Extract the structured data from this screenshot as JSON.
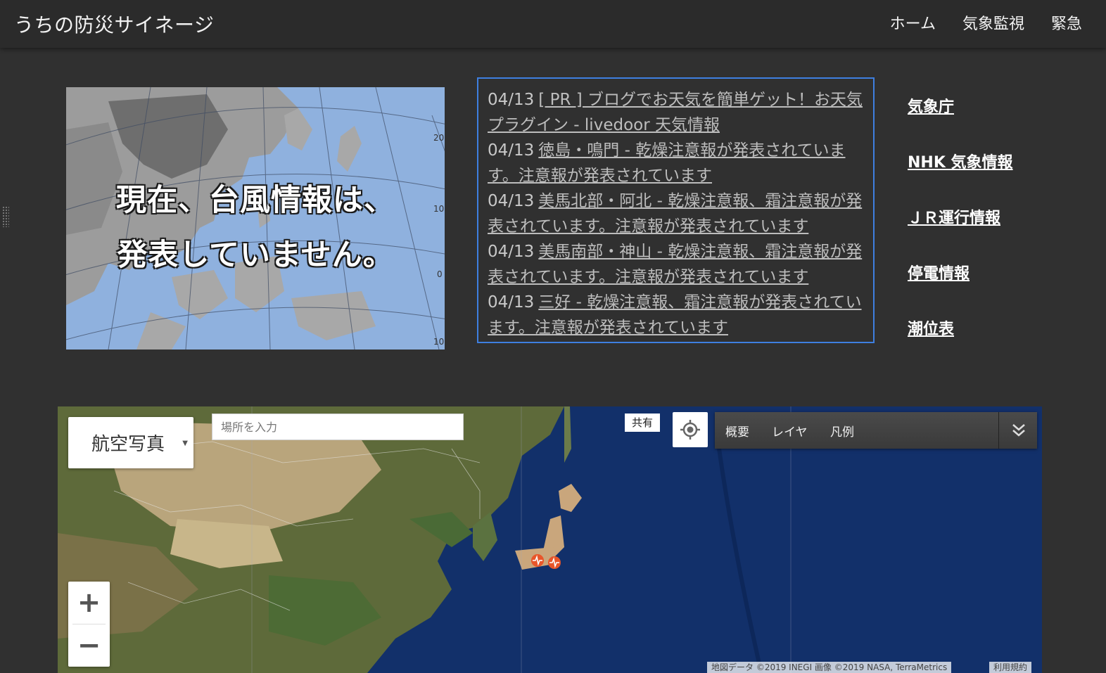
{
  "header": {
    "title": "うちの防災サイネージ",
    "nav": [
      "ホーム",
      "気象監視",
      "緊急"
    ]
  },
  "typhoon": {
    "line1": "現在、台風情報は、",
    "line2": "発表していません。",
    "lat_labels": [
      "20",
      "10",
      "0",
      "10"
    ]
  },
  "news": [
    {
      "date": "04/13",
      "text": "[ PR ] ブログでお天気を簡単ゲット！お天気プラグイン - livedoor 天気情報"
    },
    {
      "date": "04/13",
      "text": "徳島・鳴門 - 乾燥注意報が発表されています。注意報が発表されています"
    },
    {
      "date": "04/13",
      "text": "美馬北部・阿北 - 乾燥注意報、霜注意報が発表されています。注意報が発表されています"
    },
    {
      "date": "04/13",
      "text": "美馬南部・神山 - 乾燥注意報、霜注意報が発表されています。注意報が発表されています"
    },
    {
      "date": "04/13",
      "text": "三好 - 乾燥注意報、霜注意報が発表されています。注意報が発表されています"
    }
  ],
  "links": [
    "気象庁",
    "NHK 気象情報",
    "ＪＲ運行情報",
    "停電情報",
    "潮位表"
  ],
  "map": {
    "type_label": "航空写真",
    "search_placeholder": "場所を入力",
    "share_label": "共有",
    "tabs": [
      "概要",
      "レイヤ",
      "凡例"
    ],
    "zoom_in": "+",
    "zoom_out": "−",
    "attribution": "地図データ ©2019 INEGI 画像 ©2019 NASA, TerraMetrics",
    "terms": "利用規約"
  },
  "colors": {
    "background": "#303030",
    "news_border": "#3e7fe0",
    "ocean": "#8fb1de",
    "marker": "#e8562a"
  }
}
